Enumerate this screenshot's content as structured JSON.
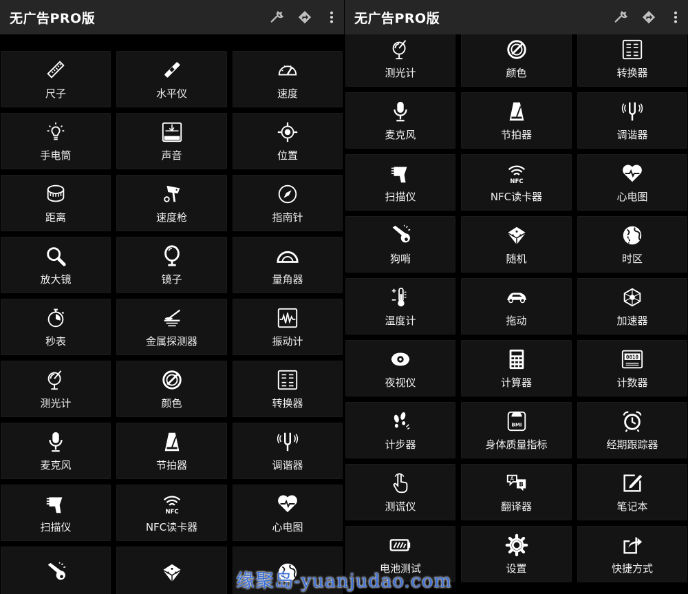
{
  "panels": [
    {
      "title": "无广告PRO版",
      "tools": [
        {
          "label": "尺子",
          "icon": "ruler-icon"
        },
        {
          "label": "水平仪",
          "icon": "level-icon"
        },
        {
          "label": "速度",
          "icon": "speedometer-icon"
        },
        {
          "label": "手电筒",
          "icon": "bulb-icon"
        },
        {
          "label": "声音",
          "icon": "sound-meter-icon"
        },
        {
          "label": "位置",
          "icon": "location-target-icon"
        },
        {
          "label": "距离",
          "icon": "tape-measure-icon"
        },
        {
          "label": "速度枪",
          "icon": "speed-camera-icon"
        },
        {
          "label": "指南针",
          "icon": "compass-icon"
        },
        {
          "label": "放大镜",
          "icon": "magnifier-icon"
        },
        {
          "label": "镜子",
          "icon": "mirror-icon"
        },
        {
          "label": "量角器",
          "icon": "protractor-icon"
        },
        {
          "label": "秒表",
          "icon": "stopwatch-icon"
        },
        {
          "label": "金属探测器",
          "icon": "metal-detector-icon"
        },
        {
          "label": "振动计",
          "icon": "vibration-icon"
        },
        {
          "label": "测光计",
          "icon": "light-meter-icon"
        },
        {
          "label": "颜色",
          "icon": "color-dial-icon"
        },
        {
          "label": "转换器",
          "icon": "converter-icon"
        },
        {
          "label": "麦克风",
          "icon": "microphone-icon"
        },
        {
          "label": "节拍器",
          "icon": "metronome-icon"
        },
        {
          "label": "调谐器",
          "icon": "tuning-fork-icon"
        },
        {
          "label": "扫描仪",
          "icon": "scanner-icon"
        },
        {
          "label": "NFC读卡器",
          "icon": "nfc-icon"
        },
        {
          "label": "心电图",
          "icon": "heart-icon"
        },
        {
          "label": "",
          "icon": "whistle-icon"
        },
        {
          "label": "",
          "icon": "dice-icon"
        },
        {
          "label": "",
          "icon": "globe-icon"
        }
      ]
    },
    {
      "title": "无广告PRO版",
      "tools": [
        {
          "label": "测光计",
          "icon": "light-meter-icon"
        },
        {
          "label": "颜色",
          "icon": "color-dial-icon"
        },
        {
          "label": "转换器",
          "icon": "converter-icon"
        },
        {
          "label": "麦克风",
          "icon": "microphone-icon"
        },
        {
          "label": "节拍器",
          "icon": "metronome-icon"
        },
        {
          "label": "调谐器",
          "icon": "tuning-fork-icon"
        },
        {
          "label": "扫描仪",
          "icon": "scanner-icon"
        },
        {
          "label": "NFC读卡器",
          "icon": "nfc-icon"
        },
        {
          "label": "心电图",
          "icon": "heart-icon"
        },
        {
          "label": "狗哨",
          "icon": "whistle-icon"
        },
        {
          "label": "随机",
          "icon": "dice-icon"
        },
        {
          "label": "时区",
          "icon": "globe-icon"
        },
        {
          "label": "温度计",
          "icon": "thermometer-icon"
        },
        {
          "label": "拖动",
          "icon": "car-icon"
        },
        {
          "label": "加速器",
          "icon": "accelerometer-icon"
        },
        {
          "label": "夜视仪",
          "icon": "night-vision-icon"
        },
        {
          "label": "计算器",
          "icon": "calculator-icon"
        },
        {
          "label": "计数器",
          "icon": "counter-icon"
        },
        {
          "label": "计步器",
          "icon": "footsteps-icon"
        },
        {
          "label": "身体质量指标",
          "icon": "bmi-scale-icon"
        },
        {
          "label": "经期跟踪器",
          "icon": "alarm-clock-icon"
        },
        {
          "label": "测谎仪",
          "icon": "finger-touch-icon"
        },
        {
          "label": "翻译器",
          "icon": "translate-icon"
        },
        {
          "label": "笔记本",
          "icon": "note-edit-icon"
        },
        {
          "label": "电池测试",
          "icon": "battery-icon"
        },
        {
          "label": "设置",
          "icon": "gear-icon"
        },
        {
          "label": "快捷方式",
          "icon": "share-icon"
        }
      ]
    }
  ],
  "toolbar_icons": [
    "wrench-icon",
    "directions-icon",
    "more-vert-icon"
  ],
  "watermark": "缘聚岛-yuanjudao.com",
  "colors": {
    "background": "#000000",
    "appbar": "#262626",
    "tile": "#141414",
    "text": "#ffffff",
    "watermark": "#3b6fd6"
  }
}
